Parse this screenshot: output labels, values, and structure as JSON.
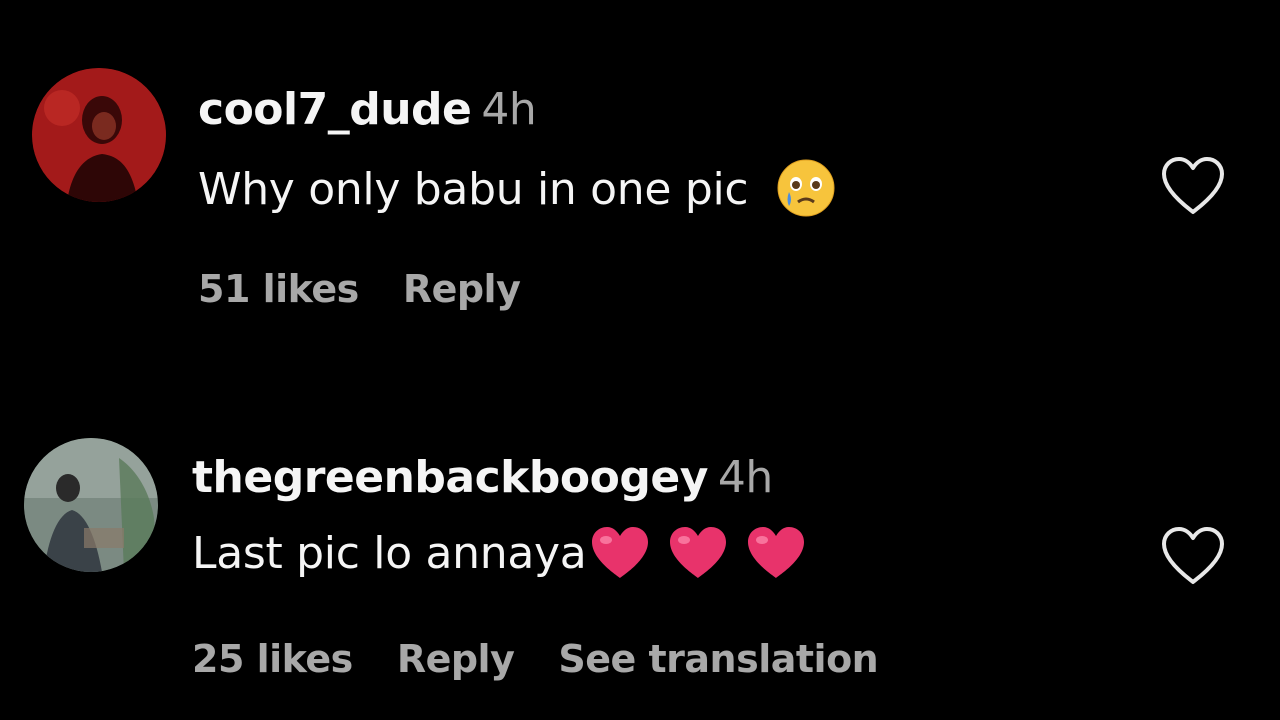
{
  "comments": [
    {
      "username": "cool7_dude",
      "time": "4h",
      "text": "Why only babu in one pic",
      "emoji": "crying-face",
      "likes": "51 likes",
      "reply": "Reply",
      "avatar_color": "#b31f1f"
    },
    {
      "username": "thegreenbackboogey",
      "time": "4h",
      "text": "Last pic lo annaya",
      "emoji": "heart",
      "likes": "25 likes",
      "reply": "Reply",
      "translation": "See translation",
      "avatar_color": "#6f7f77"
    }
  ],
  "colors": {
    "background": "#000000",
    "primary_text": "#f5f5f5",
    "secondary_text": "#a8a8a8",
    "heart_emoji": "#e8336b"
  },
  "icons": {
    "like": "heart-outline-icon"
  }
}
